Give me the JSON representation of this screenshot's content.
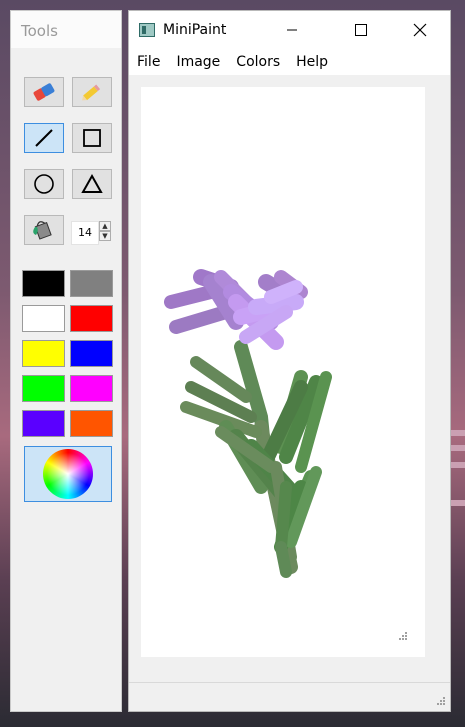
{
  "tools_window": {
    "title": "Tools",
    "tools": [
      {
        "name": "eraser-tool",
        "icon": "eraser-icon",
        "active": false
      },
      {
        "name": "pencil-tool",
        "icon": "pencil-icon",
        "active": false
      },
      {
        "name": "line-tool",
        "icon": "line-icon",
        "active": true
      },
      {
        "name": "rectangle-tool",
        "icon": "rectangle-icon",
        "active": false
      },
      {
        "name": "ellipse-tool",
        "icon": "ellipse-icon",
        "active": false
      },
      {
        "name": "triangle-tool",
        "icon": "triangle-icon",
        "active": false
      },
      {
        "name": "fill-tool",
        "icon": "paint-bucket-icon",
        "active": false
      }
    ],
    "brush_size": "14",
    "palette": [
      "#000000",
      "#808080",
      "#ffffff",
      "#ff0000",
      "#ffff00",
      "#0000ff",
      "#00ff00",
      "#ff00ff",
      "#5a00ff",
      "#ff5500"
    ],
    "color_picker_icon": "color-wheel-icon"
  },
  "main_window": {
    "title": "MiniPaint",
    "menu": [
      "File",
      "Image",
      "Colors",
      "Help"
    ],
    "controls": {
      "minimize": "minimize-icon",
      "maximize": "maximize-icon",
      "close": "close-icon"
    }
  }
}
